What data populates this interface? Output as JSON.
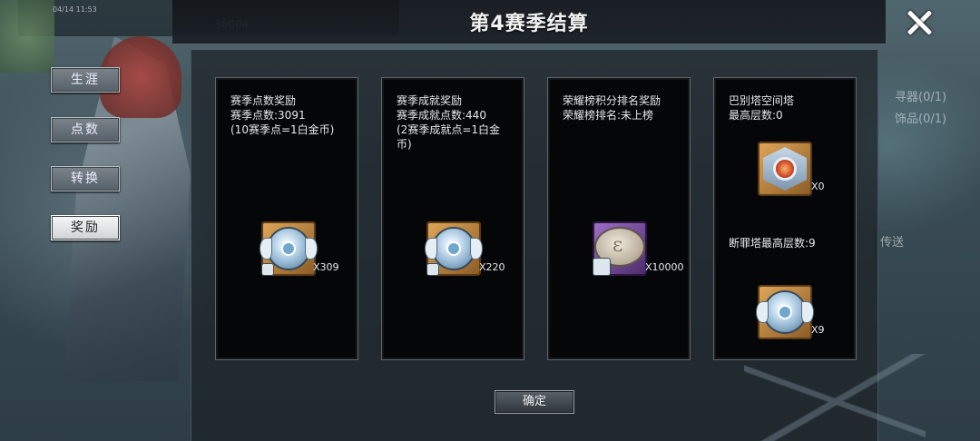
{
  "dialog": {
    "title": "第4赛季结算",
    "confirm_label": "确定"
  },
  "background": {
    "date": "04/14 11:53",
    "number": "36004",
    "right_labels": [
      "寻器(0/1)",
      "饰品(0/1)",
      "传送"
    ]
  },
  "tabs": [
    {
      "label": "生涯",
      "active": false
    },
    {
      "label": "点数",
      "active": false
    },
    {
      "label": "转换",
      "active": false
    },
    {
      "label": "奖励",
      "active": true
    }
  ],
  "cards": [
    {
      "lines": [
        "赛季点数奖励",
        "赛季点数:3091",
        "(10赛季点=1白金币)"
      ],
      "reward_icon": "platinum-medal-icon",
      "reward_qty": "X309"
    },
    {
      "lines": [
        "赛季成就奖励",
        "赛季成就点数:440",
        "(2赛季成就点=1白金",
        "币)"
      ],
      "reward_icon": "platinum-medal-icon",
      "reward_qty": "X220"
    },
    {
      "lines": [
        "荣耀榜积分排名奖励",
        "荣耀榜排名:未上榜"
      ],
      "reward_icon": "silver-coin-icon",
      "reward_qty": "X10000"
    },
    {
      "lines": [
        "巴别塔空间塔",
        "最高层数:0"
      ],
      "reward_icon": "tower-badge-icon",
      "reward_qty": "X0",
      "sub_line": "断罪塔最高层数:9",
      "sub_reward_icon": "platinum-medal-icon",
      "sub_reward_qty": "X9"
    }
  ],
  "colors": {
    "card_bg": "#050608",
    "icon_bronze": "#c8893f",
    "icon_purple": "#7a4ea0",
    "active_tab": "#f0f0f0"
  }
}
